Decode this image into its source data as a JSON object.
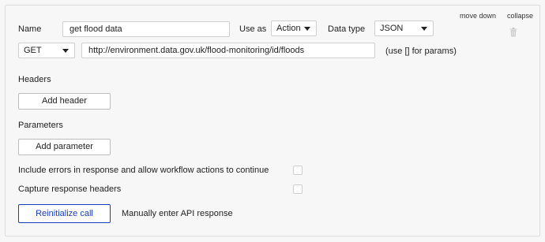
{
  "header_actions": {
    "move_down": "move down",
    "collapse": "collapse"
  },
  "name": {
    "label": "Name",
    "value": "get flood data"
  },
  "use_as": {
    "label": "Use as",
    "value": "Action"
  },
  "data_type": {
    "label": "Data type",
    "value": "JSON"
  },
  "request": {
    "method": "GET",
    "url": "http://environment.data.gov.uk/flood-monitoring/id/floods",
    "hint": "(use [] for params)"
  },
  "headers": {
    "title": "Headers",
    "button": "Add header"
  },
  "parameters": {
    "title": "Parameters",
    "button": "Add parameter"
  },
  "options": {
    "include_errors": "Include errors in response and allow workflow actions to continue",
    "capture_headers": "Capture response headers"
  },
  "actions": {
    "reinitialize": "Reinitialize call",
    "manual": "Manually enter API response"
  },
  "icons": {
    "delete": "trash-icon",
    "dropdown": "chevron-down-icon"
  },
  "colors": {
    "accent": "#1a3dbd",
    "border": "#cfcfcf",
    "background": "#f7f7f7"
  }
}
